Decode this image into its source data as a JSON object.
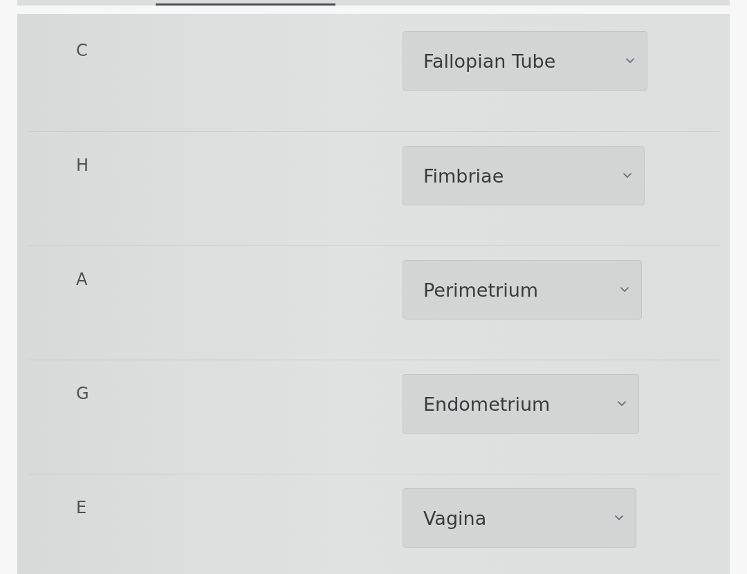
{
  "rows": [
    {
      "label": "C",
      "answer": "Fallopian Tube"
    },
    {
      "label": "H",
      "answer": "Fimbriae"
    },
    {
      "label": "A",
      "answer": "Perimetrium"
    },
    {
      "label": "G",
      "answer": "Endometrium"
    },
    {
      "label": "E",
      "answer": "Vagina"
    }
  ]
}
